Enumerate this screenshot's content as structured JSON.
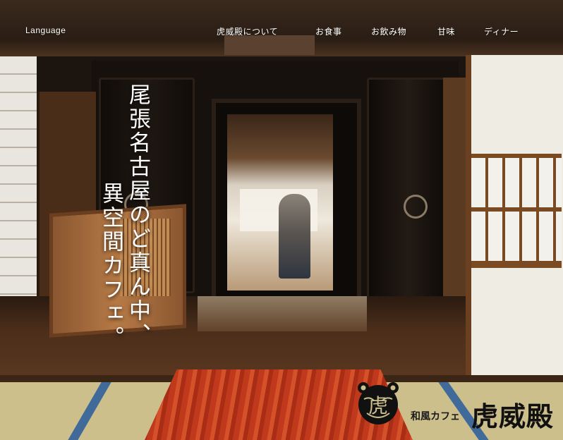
{
  "nav": {
    "language": "Language",
    "items": [
      "虎威殿について",
      "お食事",
      "お飲み物",
      "甘味",
      "ディナー"
    ]
  },
  "hero": {
    "headline_lines": [
      "尾張名古屋のど真ん中、",
      "異空間カフェ。"
    ]
  },
  "logo": {
    "mark_char": "虎",
    "subtitle": "和風カフェ",
    "title": "虎威殿"
  },
  "colors": {
    "text": "#ffffff",
    "table_red": "#c0391c",
    "tatami_edge": "#3f6a9a",
    "wood_dark": "#2a1d14"
  }
}
